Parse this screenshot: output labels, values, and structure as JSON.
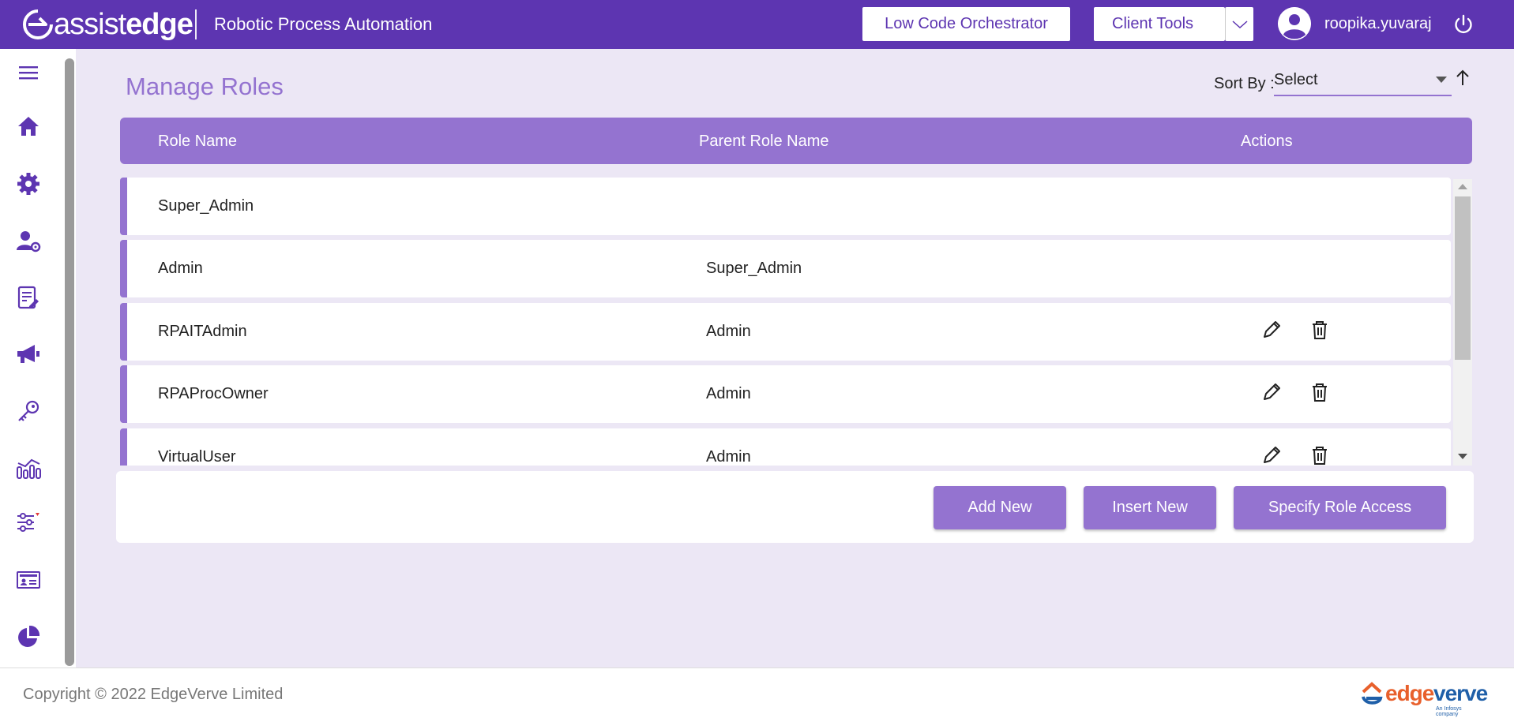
{
  "header": {
    "brand_light": "assist",
    "brand_bold": "edge",
    "app_title": "Robotic Process Automation",
    "low_code_button": "Low Code Orchestrator",
    "client_tools_button": "Client Tools",
    "username": "roopika.yuvaraj",
    "accent_color": "#5d35b1"
  },
  "sidebar": {
    "icons": [
      "menu-icon",
      "home-icon",
      "settings-icon",
      "user-settings-icon",
      "edit-document-icon",
      "megaphone-icon",
      "key-icon",
      "analytics-icon",
      "filter-settings-icon",
      "id-card-icon",
      "pie-chart-icon"
    ]
  },
  "main": {
    "page_title": "Manage Roles",
    "sort_label": "Sort By :",
    "sort_value": "Select",
    "table": {
      "columns": [
        "Role Name",
        "Parent Role Name",
        "Actions"
      ],
      "rows": [
        {
          "role": "Super_Admin",
          "parent": "",
          "actions": false
        },
        {
          "role": "Admin",
          "parent": "Super_Admin",
          "actions": false
        },
        {
          "role": "RPAITAdmin",
          "parent": "Admin",
          "actions": true
        },
        {
          "role": "RPAProcOwner",
          "parent": "Admin",
          "actions": true
        },
        {
          "role": "VirtualUser",
          "parent": "Admin",
          "actions": true
        }
      ]
    },
    "buttons": {
      "add_new": "Add New",
      "insert_new": "Insert New",
      "specify_role_access": "Specify Role Access"
    },
    "table_accent_color": "#9473d0"
  },
  "footer": {
    "copyright": "Copyright © 2022 EdgeVerve Limited",
    "logo_text_a": "edge",
    "logo_text_b": "verve",
    "logo_tagline": "An Infosys company"
  }
}
